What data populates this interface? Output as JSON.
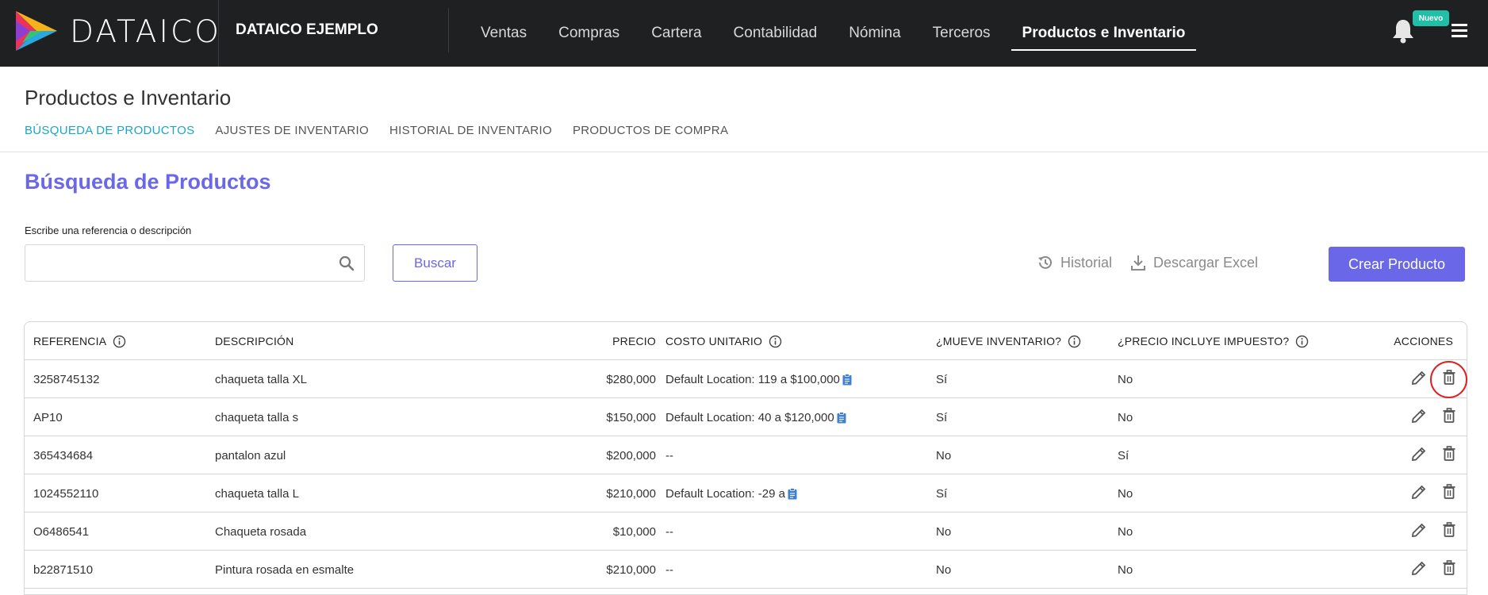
{
  "header": {
    "brand": "DATAICO",
    "company": "DATAICO EJEMPLO",
    "nav": [
      {
        "label": "Ventas",
        "active": false
      },
      {
        "label": "Compras",
        "active": false
      },
      {
        "label": "Cartera",
        "active": false
      },
      {
        "label": "Contabilidad",
        "active": false
      },
      {
        "label": "Nómina",
        "active": false
      },
      {
        "label": "Terceros",
        "active": false
      },
      {
        "label": "Productos e Inventario",
        "active": true
      }
    ],
    "badge": "Nuevo"
  },
  "page": {
    "title": "Productos e Inventario",
    "tabs": [
      {
        "label": "BÚSQUEDA DE PRODUCTOS",
        "active": true
      },
      {
        "label": "AJUSTES DE INVENTARIO",
        "active": false
      },
      {
        "label": "HISTORIAL DE INVENTARIO",
        "active": false
      },
      {
        "label": "PRODUCTOS DE COMPRA",
        "active": false
      }
    ]
  },
  "search": {
    "section_title": "Búsqueda de Productos",
    "label": "Escribe una referencia o descripción",
    "value": "",
    "placeholder": "",
    "button": "Buscar"
  },
  "toolbar": {
    "historial": "Historial",
    "excel": "Descargar Excel",
    "crear": "Crear Producto"
  },
  "table": {
    "headers": {
      "referencia": "REFERENCIA",
      "descripcion": "DESCRIPCIÓN",
      "precio": "PRECIO",
      "costo": "COSTO UNITARIO",
      "mueve": "¿MUEVE INVENTARIO?",
      "impuesto": "¿PRECIO INCLUYE IMPUESTO?",
      "acciones": "ACCIONES"
    },
    "rows": [
      {
        "ref": "3258745132",
        "desc": "chaqueta talla XL",
        "precio": "$280,000",
        "costo": "Default Location: 119 a $100,000",
        "has_clip": true,
        "mueve": "Sí",
        "impuesto": "No"
      },
      {
        "ref": "AP10",
        "desc": "chaqueta talla s",
        "precio": "$150,000",
        "costo": "Default Location: 40 a $120,000",
        "has_clip": true,
        "mueve": "Sí",
        "impuesto": "No"
      },
      {
        "ref": "365434684",
        "desc": "pantalon azul",
        "precio": "$200,000",
        "costo": "--",
        "has_clip": false,
        "mueve": "No",
        "impuesto": "Sí"
      },
      {
        "ref": "1024552110",
        "desc": "chaqueta talla L",
        "precio": "$210,000",
        "costo": "Default Location: -29 a",
        "has_clip": true,
        "mueve": "Sí",
        "impuesto": "No"
      },
      {
        "ref": "O6486541",
        "desc": "Chaqueta rosada",
        "precio": "$10,000",
        "costo": "--",
        "has_clip": false,
        "mueve": "No",
        "impuesto": "No"
      },
      {
        "ref": "b22871510",
        "desc": "Pintura rosada en esmalte",
        "precio": "$210,000",
        "costo": "--",
        "has_clip": false,
        "mueve": "No",
        "impuesto": "No"
      }
    ]
  },
  "colors": {
    "accent": "#6a67e8",
    "tab_active": "#1aa6c6",
    "topbar": "#1f2022",
    "badge": "#1fbfa8",
    "highlight": "#e02020"
  }
}
